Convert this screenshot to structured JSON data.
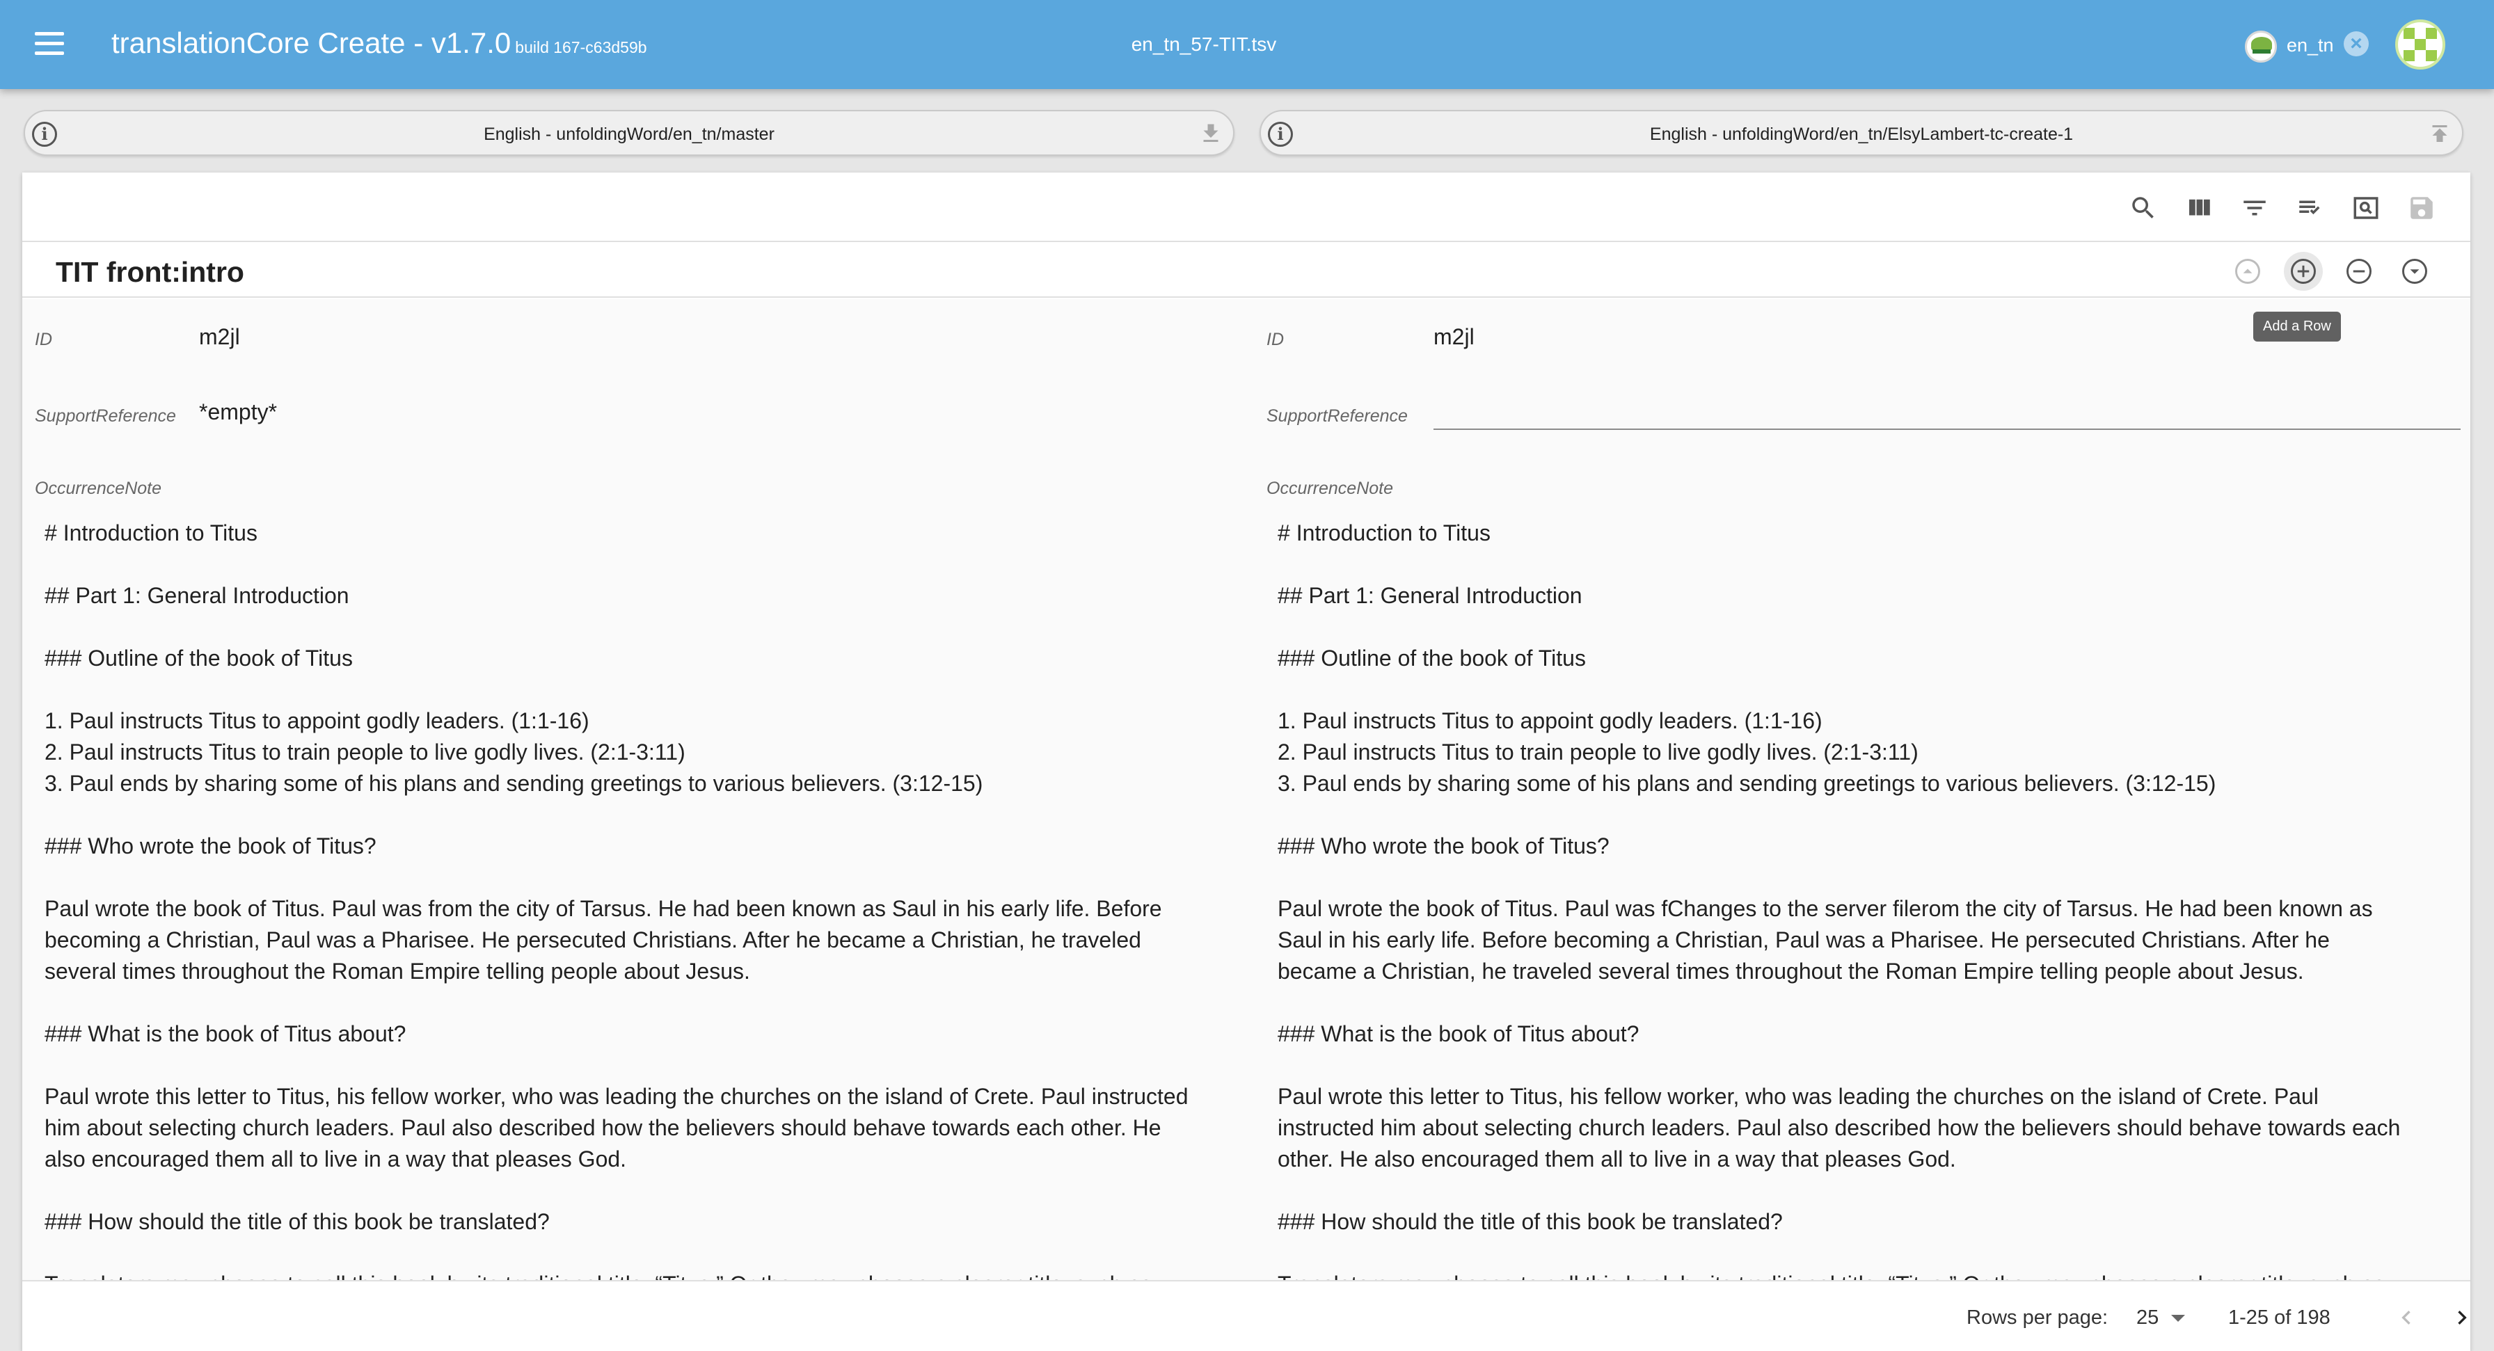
{
  "appbar": {
    "title": "translationCore Create - v1.7.0",
    "build": "build 167-c63d59b",
    "file_name": "en_tn_57-TIT.tsv",
    "user_label": "en_tn",
    "icons": [
      "menu-icon",
      "close-icon",
      "avatar"
    ]
  },
  "repos": {
    "left": {
      "label": "English - unfoldingWord/en_tn/master",
      "action_icon": "download-icon"
    },
    "right": {
      "label": "English - unfoldingWord/en_tn/ElsyLambert-tc-create-1",
      "action_icon": "publish-icon"
    }
  },
  "toolbar": {
    "icons": [
      "search-icon",
      "columns-icon",
      "filter-icon",
      "view-rows-icon",
      "preview-icon",
      "save-icon"
    ]
  },
  "row": {
    "title": "TIT front:intro",
    "actions": [
      "move-up-icon",
      "add-row-icon",
      "delete-row-icon",
      "move-down-icon"
    ],
    "tooltip": "Add a Row"
  },
  "source": {
    "id_label": "ID",
    "id_value": "m2jl",
    "support_label": "SupportReference",
    "support_value": "*empty*",
    "note_label": "OccurrenceNote",
    "note_lines": [
      "# Introduction to Titus",
      "",
      "## Part 1: General Introduction",
      "",
      "### Outline of the book of Titus",
      "",
      "1. Paul instructs Titus to appoint godly leaders. (1:1-16)",
      "2. Paul instructs Titus to train people to live godly lives. (2:1-3:11)",
      "3. Paul ends by sharing some of his plans and sending greetings to various believers. (3:12-15)",
      "",
      "### Who wrote the book of Titus?",
      "",
      "Paul wrote the book of Titus. Paul was from the city of Tarsus. He had been known as Saul in his early life. Before",
      "becoming a Christian, Paul was a Pharisee. He persecuted Christians. After he became a Christian, he traveled",
      "several times throughout the Roman Empire telling people about Jesus.",
      "",
      "### What is the book of Titus about?",
      "",
      "Paul wrote this letter to Titus, his fellow worker, who was leading the churches on the island of Crete. Paul instructed",
      "him about selecting church leaders. Paul also described how the believers should behave towards each other. He",
      "also encouraged them all to live in a way that pleases God.",
      "",
      "### How should the title of this book be translated?",
      "",
      "Translators may choose to call this book by its traditional title, “Titus.” Or they may choose a clearer title, such as"
    ]
  },
  "target": {
    "id_label": "ID",
    "id_value": "m2jl",
    "support_label": "SupportReference",
    "support_value": "",
    "note_label": "OccurrenceNote",
    "note_lines": [
      "# Introduction to Titus",
      "",
      "## Part 1: General Introduction",
      "",
      "### Outline of the book of Titus",
      "",
      "1. Paul instructs Titus to appoint godly leaders. (1:1-16)",
      "2. Paul instructs Titus to train people to live godly lives. (2:1-3:11)",
      "3. Paul ends by sharing some of his plans and sending greetings to various believers. (3:12-15)",
      "",
      "### Who wrote the book of Titus?",
      "",
      "Paul wrote the book of Titus. Paul was fChanges to the server filerom the city of Tarsus. He had been known as",
      "Saul in his early life. Before becoming a Christian, Paul was a Pharisee. He persecuted Christians. After he",
      "became a Christian, he traveled several times throughout the Roman Empire telling people about Jesus.",
      "",
      "### What is the book of Titus about?",
      "",
      "Paul wrote this letter to Titus, his fellow worker, who was leading the churches on the island of Crete. Paul",
      "instructed him about selecting church leaders. Paul also described how the believers should behave towards each",
      "other. He also encouraged them all to live in a way that pleases God.",
      "",
      "### How should the title of this book be translated?",
      "",
      "Translators may choose to call this book by its traditional title, “Titus.” Or they may choose a clearer title, such as"
    ]
  },
  "footer": {
    "rows_per_page_label": "Rows per page:",
    "rows_per_page_value": "25",
    "range": "1-25 of 198",
    "icons": [
      "chevron-left-icon",
      "chevron-right-icon"
    ]
  },
  "colors": {
    "appbar": "#5aa7dd",
    "text": "#212121",
    "label": "#666666"
  }
}
